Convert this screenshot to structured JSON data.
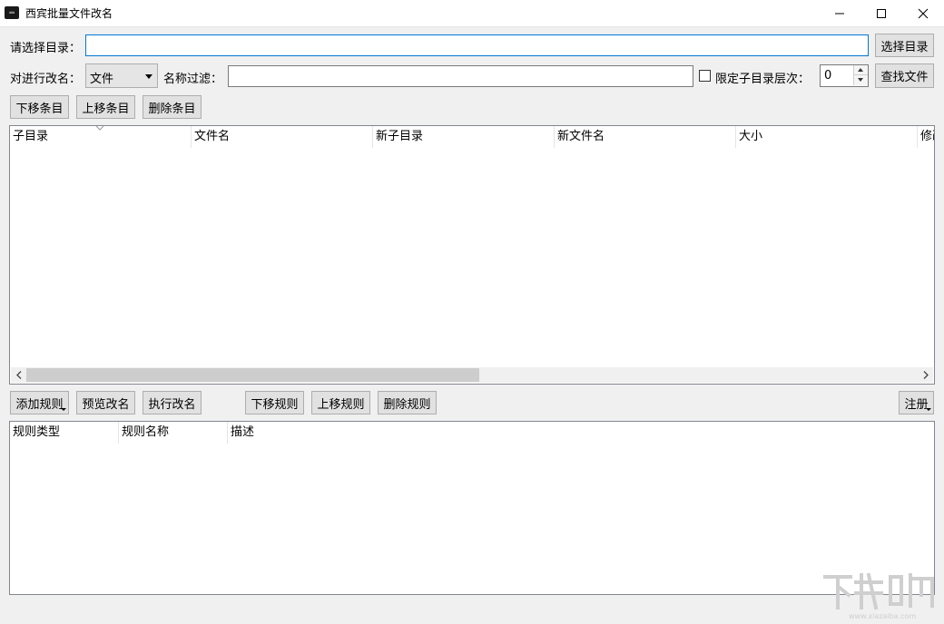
{
  "window": {
    "title": "西宾批量文件改名",
    "icon": "app-icon"
  },
  "directory": {
    "label": "请选择目录：",
    "value": "",
    "browse_label": "选择目录"
  },
  "filter_row": {
    "rename_target_label": "对进行改名：",
    "rename_target_value": "文件",
    "name_filter_label": "名称过滤：",
    "name_filter_value": "",
    "limit_depth_label": "限定子目录层次：",
    "limit_depth_checked": false,
    "depth_value": "0",
    "find_label": "查找文件"
  },
  "item_toolbar": {
    "move_down": "下移条目",
    "move_up": "上移条目",
    "delete": "删除条目"
  },
  "file_list": {
    "columns": [
      "子目录",
      "文件名",
      "新子目录",
      "新文件名",
      "大小",
      "修改"
    ],
    "rows": []
  },
  "rule_toolbar": {
    "add_rule": "添加规则",
    "preview": "预览改名",
    "execute": "执行改名",
    "move_down": "下移规则",
    "move_up": "上移规则",
    "delete": "删除规则",
    "register": "注册"
  },
  "rule_list": {
    "columns": [
      "规则类型",
      "规则名称",
      "描述"
    ],
    "rows": []
  },
  "watermark": {
    "text": "下载吧",
    "url_text": "www.xiazaiba.com"
  },
  "colors": {
    "focus_border": "#0078d7",
    "button_bg": "#e1e1e1",
    "window_bg": "#f0f0f0"
  }
}
